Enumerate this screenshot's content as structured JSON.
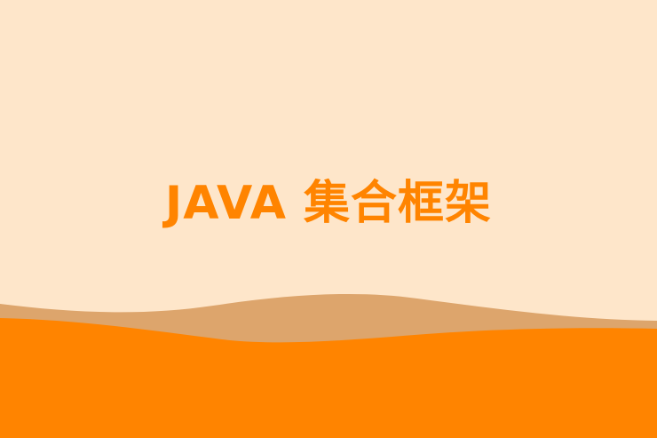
{
  "banner": {
    "title": "JAVA 集合框架"
  },
  "colors": {
    "background": "#fee6ca",
    "title": "#ff8400",
    "back_wave": "#dda56c",
    "front_wave": "#ff8400"
  }
}
